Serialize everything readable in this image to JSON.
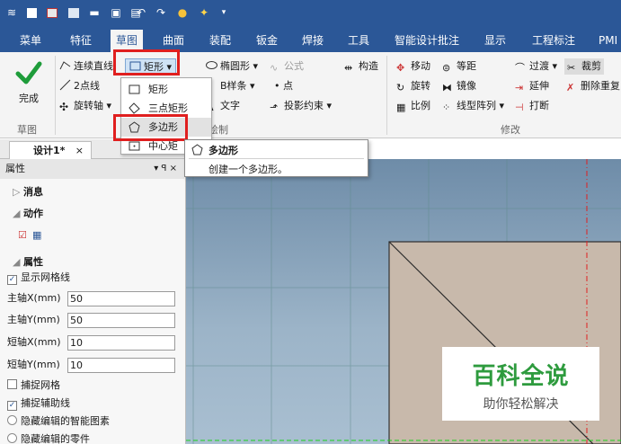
{
  "titlebar": {
    "icons": [
      "logo-icon",
      "new-file-icon",
      "open-icon",
      "image-icon",
      "folder-icon",
      "save-icon",
      "save-all-icon",
      "undo-icon",
      "redo-icon",
      "gem-icon",
      "sparkle-icon",
      "dropdown-icon"
    ]
  },
  "menu": [
    "菜单",
    "特征",
    "草图",
    "曲面",
    "装配",
    "钣金",
    "焊接",
    "工具",
    "智能设计批注",
    "显示",
    "工程标注",
    "PMI"
  ],
  "ribbon": {
    "finish_label": "完成",
    "sketch_group": "草图",
    "draw_group": "绘制",
    "modify_group": "修改",
    "continuous_line": "连续直线",
    "two_point_line": "2点线",
    "rotate_axis": "旋转轴",
    "rectangle": "矩形",
    "ellipse": "椭圆形",
    "formula": "公式",
    "construct": "构造",
    "bspline": "B样条",
    "point": "点",
    "text": "文字",
    "projection": "投影约束",
    "move": "移动",
    "equidistant": "等距",
    "transition": "过渡",
    "trim": "裁剪",
    "rotate": "旋转",
    "mirror": "镜像",
    "extend": "延伸",
    "delete_redundant": "删除重复",
    "scale": "比例",
    "linear_array": "线型阵列",
    "break": "打断"
  },
  "dropdown": {
    "items": [
      "矩形",
      "三点矩形",
      "多边形",
      "中心矩"
    ]
  },
  "tooltip": {
    "title": "多边形",
    "desc": "创建一个多边形。"
  },
  "tab": {
    "label": "设计1*",
    "close": "×"
  },
  "panel": {
    "title": "属性",
    "pin": "▾ ꟼ ×",
    "sec_message": "消息",
    "sec_action": "动作",
    "sec_properties": "属性",
    "show_grid": "显示网格线",
    "main_x_label": "主轴X(mm)",
    "main_x": "50",
    "main_y_label": "主轴Y(mm)",
    "main_y": "50",
    "minor_x_label": "短轴X(mm)",
    "minor_x": "10",
    "minor_y_label": "短轴Y(mm)",
    "minor_y": "10",
    "snap_grid": "捕捉网格",
    "snap_guide": "捕捉辅助线",
    "hide_smart": "隐藏编辑的智能图素",
    "hide_parts": "隐藏编辑的零件"
  },
  "watermark": {
    "title": "百科全说",
    "subtitle": "助你轻松解决"
  },
  "colors": {
    "brand": "#2b5797",
    "highlight": "#e01f1f",
    "accent_green": "#1e9c3a"
  }
}
